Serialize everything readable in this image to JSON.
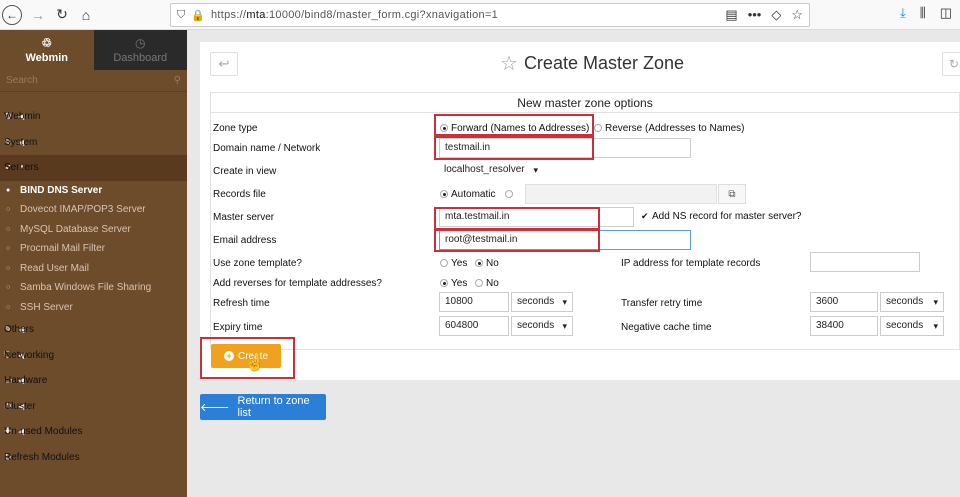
{
  "browser": {
    "url_prefix": "https://",
    "url_host": "mta",
    "url_rest": ":10000/bind8/master_form.cgi?xnavigation=1",
    "more_icon": "•••"
  },
  "sidebar": {
    "webmin_tab": "Webmin",
    "dashboard_tab": "Dashboard",
    "search_placeholder": "Search",
    "menu": [
      {
        "label": "Webmin",
        "icon": "gear-icon"
      },
      {
        "label": "System",
        "icon": "wrench-icon"
      },
      {
        "label": "Servers",
        "icon": "rocket-icon"
      },
      {
        "label": "Others",
        "icon": "wrench-icon"
      },
      {
        "label": "Networking",
        "icon": "shield-icon"
      },
      {
        "label": "Hardware",
        "icon": "hdd-icon"
      },
      {
        "label": "Cluster",
        "icon": "power-icon"
      },
      {
        "label": "Un-used Modules",
        "icon": "puzzle-icon"
      },
      {
        "label": "Refresh Modules",
        "icon": "refresh-icon"
      }
    ],
    "servers_sub": [
      "BIND DNS Server",
      "Dovecot IMAP/POP3 Server",
      "MySQL Database Server",
      "Procmail Mail Filter",
      "Read User Mail",
      "Samba Windows File Sharing",
      "SSH Server"
    ]
  },
  "page": {
    "title": "Create Master Zone",
    "section_header": "New master zone options"
  },
  "form": {
    "zone_type_label": "Zone type",
    "zone_type_forward": "Forward (Names to Addresses)",
    "zone_type_reverse": "Reverse (Addresses to Names)",
    "domain_label": "Domain name / Network",
    "domain_value": "testmail.in",
    "view_label": "Create in view",
    "view_value": "localhost_resolver",
    "records_label": "Records file",
    "records_automatic": "Automatic",
    "master_label": "Master server",
    "master_value": "mta.testmail.in",
    "add_ns_label": "Add NS record for master server?",
    "email_label": "Email address",
    "email_value": "root@testmail.in",
    "template_label": "Use zone template?",
    "yes": "Yes",
    "no": "No",
    "ip_template_label": "IP address for template records",
    "reverses_label": "Add reverses for template addresses?",
    "refresh_label": "Refresh time",
    "refresh_value": "10800",
    "retry_label": "Transfer retry time",
    "retry_value": "3600",
    "expiry_label": "Expiry time",
    "expiry_value": "604800",
    "negcache_label": "Negative cache time",
    "negcache_value": "38400",
    "unit": "seconds"
  },
  "buttons": {
    "create": "Create",
    "return": "Return to zone list"
  },
  "colors": {
    "sidebar": "#6d4c2c",
    "create": "#f0a21e",
    "return": "#2b7fd6",
    "highlight": "#c8303a"
  }
}
